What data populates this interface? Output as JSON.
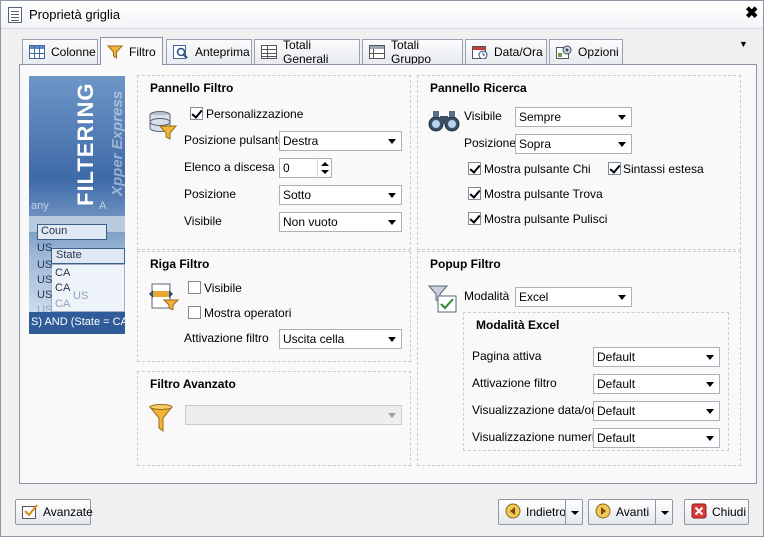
{
  "window": {
    "title": "Proprietà griglia",
    "close_glyph": "✖"
  },
  "tabs": [
    {
      "label": "Colonne",
      "icon": "grid-icon",
      "active": false
    },
    {
      "label": "Filtro",
      "icon": "funnel-icon",
      "active": true
    },
    {
      "label": "Anteprima",
      "icon": "magnifier-icon",
      "active": false
    },
    {
      "label": "Totali Generali",
      "icon": "table-icon",
      "active": false
    },
    {
      "label": "Totali Gruppo",
      "icon": "group-table-icon",
      "active": false
    },
    {
      "label": "Data/Ora",
      "icon": "calendar-icon",
      "active": false
    },
    {
      "label": "Opzioni",
      "icon": "options-icon",
      "active": false
    }
  ],
  "banner": {
    "word": "FILTERING",
    "sub": "Xpper Express",
    "fragments": [
      "any",
      "A",
      "Coun",
      "State",
      "US",
      "US",
      "US",
      "US",
      "CA",
      "CA",
      "US",
      "CA",
      "US"
    ],
    "footer": "S) AND (State = CA)"
  },
  "pannello_filtro": {
    "title": "Pannello Filtro",
    "personalizzazione": {
      "label": "Personalizzazione",
      "checked": true
    },
    "posizione_pulsante": {
      "label": "Posizione pulsante",
      "value": "Destra"
    },
    "elenco_a_discesa": {
      "label": "Elenco a discesa",
      "value": "0"
    },
    "posizione": {
      "label": "Posizione",
      "value": "Sotto"
    },
    "visibile": {
      "label": "Visibile",
      "value": "Non vuoto"
    }
  },
  "riga_filtro": {
    "title": "Riga Filtro",
    "visibile": {
      "label": "Visibile",
      "checked": false
    },
    "mostra_operatori": {
      "label": "Mostra operatori",
      "checked": false
    },
    "attivazione_filtro": {
      "label": "Attivazione filtro",
      "value": "Uscita cella"
    }
  },
  "filtro_avanzato": {
    "title": "Filtro Avanzato",
    "value": ""
  },
  "pannello_ricerca": {
    "title": "Pannello Ricerca",
    "visibile": {
      "label": "Visibile",
      "value": "Sempre"
    },
    "posizione": {
      "label": "Posizione",
      "value": "Sopra"
    },
    "mostra_chiudi": {
      "label": "Mostra pulsante Chiudi",
      "checked": true
    },
    "sintassi_estesa": {
      "label": "Sintassi estesa",
      "checked": true
    },
    "mostra_trova": {
      "label": "Mostra pulsante Trova",
      "checked": true
    },
    "mostra_pulisci": {
      "label": "Mostra pulsante Pulisci",
      "checked": true
    }
  },
  "popup_filtro": {
    "title": "Popup Filtro",
    "modalita": {
      "label": "Modalità",
      "value": "Excel"
    },
    "excel": {
      "title": "Modalità Excel",
      "pagina_attiva": {
        "label": "Pagina attiva",
        "value": "Default"
      },
      "attivazione_filtro": {
        "label": "Attivazione filtro",
        "value": "Default"
      },
      "visualizzazione_data_ora": {
        "label": "Visualizzazione data/ora",
        "value": "Default"
      },
      "visualizzazione_numeri": {
        "label": "Visualizzazione numeri",
        "value": "Default"
      }
    }
  },
  "footer": {
    "avanzate": "Avanzate",
    "indietro": "Indietro",
    "avanti": "Avanti",
    "chiudi": "Chiudi"
  },
  "colors": {
    "highlight": "#e01010",
    "panel_bg": "#f9f9f9",
    "accent_blue": "#2f5c98"
  }
}
